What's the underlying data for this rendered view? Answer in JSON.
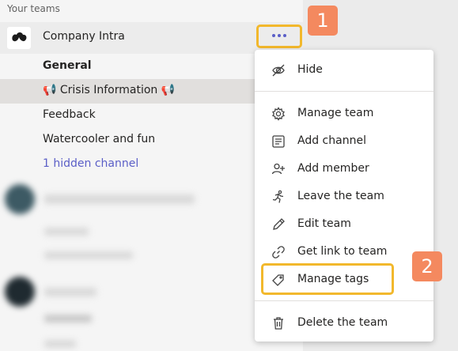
{
  "sidebar": {
    "section_label": "Your teams",
    "team": {
      "name": "Company Intra",
      "more_icon": "more-options-icon"
    },
    "channels": {
      "general": "General",
      "crisis": "📢 Crisis Information 📢",
      "feedback": "Feedback",
      "watercooler": "Watercooler and fun",
      "hidden": "1 hidden channel"
    }
  },
  "badges": {
    "first": "1",
    "second": "2"
  },
  "menu": {
    "hide": "Hide",
    "manage_team": "Manage team",
    "add_channel": "Add channel",
    "add_member": "Add member",
    "leave_team": "Leave the team",
    "edit_team": "Edit team",
    "get_link": "Get link to team",
    "manage_tags": "Manage tags",
    "delete_team": "Delete the team"
  },
  "colors": {
    "accent": "#5b5fc7",
    "highlight": "#f2b82c",
    "badge": "#f4895f"
  }
}
